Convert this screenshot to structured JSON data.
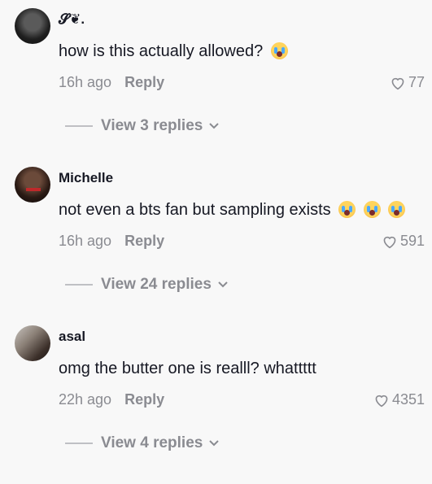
{
  "comments": [
    {
      "username": "𝓢❦.",
      "text": "how is this actually allowed?",
      "emoji_count": 1,
      "time": "16h ago",
      "reply_label": "Reply",
      "likes": "77",
      "view_replies": "View 3 replies"
    },
    {
      "username": "Michelle",
      "text": "not even a bts fan but sampling exists",
      "emoji_count": 3,
      "time": "16h ago",
      "reply_label": "Reply",
      "likes": "591",
      "view_replies": "View 24 replies"
    },
    {
      "username": "asal",
      "text": "omg the butter one is realll? whattttt",
      "emoji_count": 0,
      "time": "22h ago",
      "reply_label": "Reply",
      "likes": "4351",
      "view_replies": "View 4 replies"
    }
  ],
  "icons": {
    "emoji": "loudly-crying-face-icon",
    "like": "heart-outline-icon",
    "expand": "chevron-down-icon"
  }
}
